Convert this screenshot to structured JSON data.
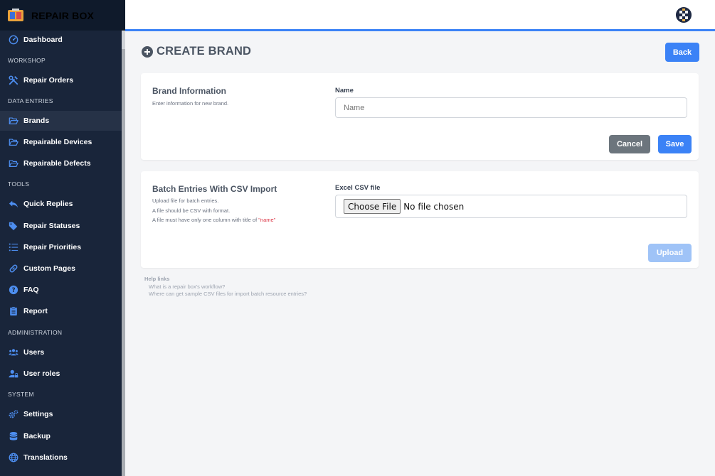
{
  "app": {
    "name": "REPAIR BOX"
  },
  "sidebar": {
    "sections": {
      "workshop": "WORKSHOP",
      "data_entries": "DATA ENTRIES",
      "tools": "TOOLS",
      "administration": "ADMINISTRATION",
      "system": "SYSTEM"
    },
    "items": {
      "dashboard": "Dashboard",
      "repair_orders": "Repair Orders",
      "brands": "Brands",
      "repairable_devices": "Repairable Devices",
      "repairable_defects": "Repairable Defects",
      "quick_replies": "Quick Replies",
      "repair_statuses": "Repair Statuses",
      "repair_priorities": "Repair Priorities",
      "custom_pages": "Custom Pages",
      "faq": "FAQ",
      "report": "Report",
      "users": "Users",
      "user_roles": "User roles",
      "settings": "Settings",
      "backup": "Backup",
      "translations": "Translations"
    },
    "active_item": "brands",
    "icon_color": "#4d8ef0"
  },
  "page": {
    "title": "CREATE BRAND",
    "back_label": "Back"
  },
  "brand_card": {
    "title": "Brand Information",
    "description": "Enter information for new brand.",
    "name_label": "Name",
    "name_placeholder": "Name",
    "name_value": "",
    "cancel_label": "Cancel",
    "save_label": "Save"
  },
  "csv_card": {
    "title": "Batch Entries With CSV Import",
    "desc_line1": "Upload file for batch entries.",
    "desc_line2": "A file should be CSV with format.",
    "desc_line3_prefix": "A file must have only one column with title of ",
    "desc_line3_highlight": "\"name\"",
    "file_label": "Excel CSV file",
    "choose_file_label": "Choose File",
    "file_status": "No file chosen",
    "upload_label": "Upload"
  },
  "help": {
    "heading": "Help links",
    "links": [
      "What is a repair box's workflow?",
      "Where can get sample CSV files for import batch resource entries?"
    ]
  },
  "colors": {
    "accent": "#3b82f6",
    "sidebar_bg": "#19253a",
    "secondary": "#6c757d",
    "danger_text": "#dc3545"
  }
}
